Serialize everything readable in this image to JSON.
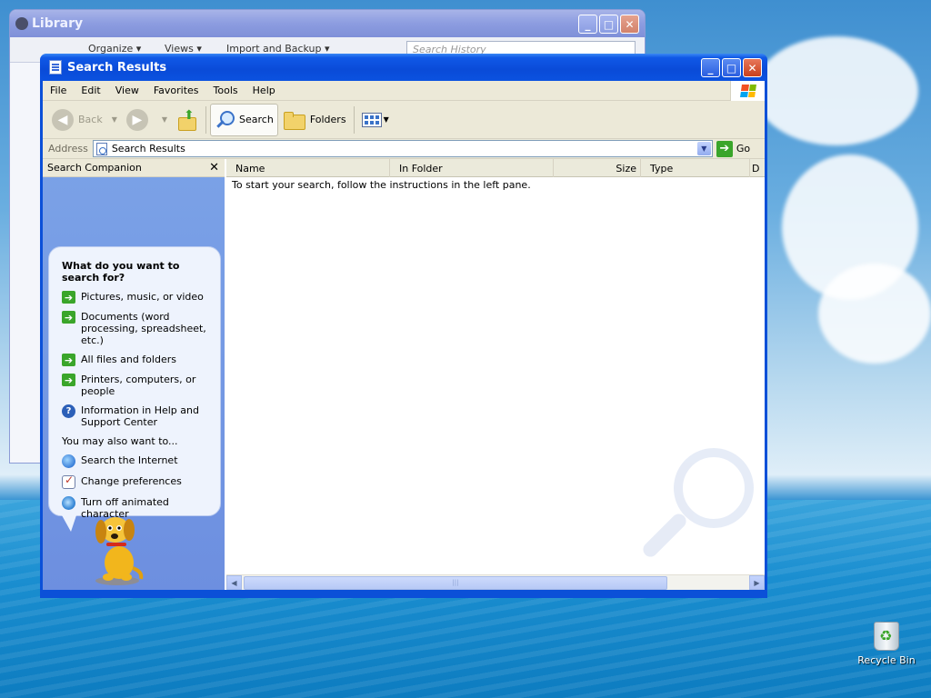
{
  "desktop": {
    "recycle_bin_label": "Recycle Bin",
    "colors": {
      "window_frame": "#0b50d8",
      "companion_bg": "#7ba2e7",
      "go_green": "#3aa52a"
    }
  },
  "library_window": {
    "title": "Library",
    "toolbar": {
      "organize": "Organize ▾",
      "views": "Views ▾",
      "import_backup": "Import and Backup ▾"
    },
    "search_placeholder": "Search History"
  },
  "main_window": {
    "title": "Search Results",
    "menu": [
      "File",
      "Edit",
      "View",
      "Favorites",
      "Tools",
      "Help"
    ],
    "toolbar": {
      "back": "Back",
      "search": "Search",
      "folders": "Folders"
    },
    "address": {
      "label": "Address",
      "value": "Search Results",
      "go": "Go"
    },
    "companion": {
      "header": "Search Companion",
      "question": "What do you want to search for?",
      "options": [
        {
          "label": "Pictures, music, or video",
          "icon": "green-arrow-icon"
        },
        {
          "label": "Documents (word processing, spreadsheet, etc.)",
          "icon": "green-arrow-icon"
        },
        {
          "label": "All files and folders",
          "icon": "green-arrow-icon"
        },
        {
          "label": "Printers, computers, or people",
          "icon": "green-arrow-icon"
        },
        {
          "label": "Information in Help and Support Center",
          "icon": "help-icon"
        }
      ],
      "also_label": "You may also want to...",
      "also_links": [
        {
          "label": "Search the Internet",
          "icon": "internet-search-icon"
        },
        {
          "label": "Change preferences",
          "icon": "preferences-icon"
        },
        {
          "label": "Turn off animated character",
          "icon": "animated-character-icon"
        }
      ]
    },
    "results": {
      "columns": [
        "Name",
        "In Folder",
        "Size",
        "Type",
        "D"
      ],
      "empty_message": "To start your search, follow the instructions in the left pane."
    }
  }
}
